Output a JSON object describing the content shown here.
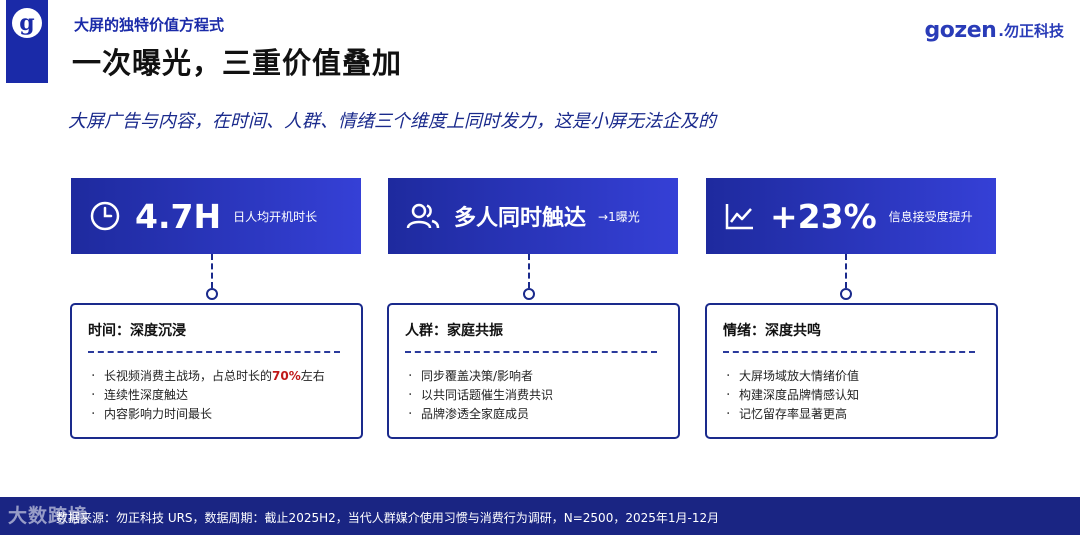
{
  "header": {
    "subtitle": "大屏的独特价值方程式",
    "title": "一次曝光，三重价值叠加",
    "brand_main": "gozen",
    "brand_cn": ".勿正科技"
  },
  "lead": "大屏广告与内容，在时间、人群、情绪三个维度上同时发力，这是小屏无法企及的",
  "cards": [
    {
      "icon": "clock-icon",
      "big": "4.7H",
      "small": "日人均开机时长",
      "heading": "时间：深度沉浸",
      "items": [
        "长视频消费主战场，占总时长的",
        "连续性深度触达",
        "内容影响力时间最长"
      ],
      "highlight": "70%",
      "highlight_suffix": "左右"
    },
    {
      "icon": "users-icon",
      "big": "多人同时触达",
      "small": "→1曝光",
      "heading": "人群：家庭共振",
      "items": [
        "同步覆盖决策/影响者",
        "以共同话题催生消费共识",
        "品牌渗透全家庭成员"
      ]
    },
    {
      "icon": "trend-chart-icon",
      "big": "+23%",
      "small": "信息接受度提升",
      "heading": "情绪：深度共鸣",
      "items": [
        "大屏场域放大情绪价值",
        "构建深度品牌情感认知",
        "记忆留存率显著更高"
      ]
    }
  ],
  "footer": {
    "watermark": "大数跨境",
    "source": "数据来源：勿正科技 URS，数据周期：截止2025H2，当代人群媒介使用习惯与消费行为调研，N=2500，2025年1月-12月"
  },
  "colors": {
    "primary": "#1a2a8c",
    "accent_red": "#c01818",
    "footer": "#1a2583"
  }
}
